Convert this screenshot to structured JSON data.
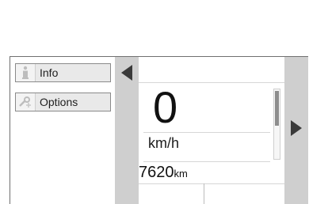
{
  "menu": {
    "items": [
      {
        "label": "Info",
        "icon": "info-icon"
      },
      {
        "label": "Options",
        "icon": "wrench-icon"
      }
    ]
  },
  "display": {
    "speed_value": "0",
    "speed_unit": "km/h",
    "odometer_value": "7620",
    "odometer_unit": "km"
  },
  "colors": {
    "side_bar": "#cfcfcf",
    "arrow": "#3a3a3a",
    "button_bg": "#e9e9e9"
  }
}
